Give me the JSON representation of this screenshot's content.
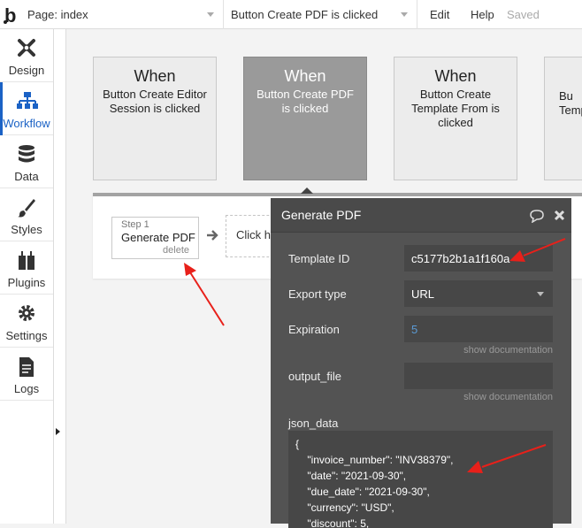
{
  "topbar": {
    "page_select": "Page: index",
    "event_select": "Button Create PDF is clicked",
    "menu_edit": "Edit",
    "menu_help": "Help",
    "status": "Saved"
  },
  "sidebar": {
    "items": [
      {
        "label": "Design",
        "icon": "design-icon"
      },
      {
        "label": "Workflow",
        "icon": "workflow-icon",
        "active": true
      },
      {
        "label": "Data",
        "icon": "data-icon"
      },
      {
        "label": "Styles",
        "icon": "brush-icon"
      },
      {
        "label": "Plugins",
        "icon": "plugins-icon"
      },
      {
        "label": "Settings",
        "icon": "gear-icon"
      },
      {
        "label": "Logs",
        "icon": "logs-icon"
      }
    ]
  },
  "events": [
    {
      "when": "When",
      "text": "Button Create Editor Session is clicked"
    },
    {
      "when": "When",
      "text": "Button Create PDF is clicked",
      "selected": true
    },
    {
      "when": "When",
      "text": "Button Create Template From is clicked"
    },
    {
      "when": "",
      "text": "Bu Temp"
    }
  ],
  "actions": {
    "step_label": "Step 1",
    "step_title": "Generate PDF",
    "step_delete": "delete",
    "click_here": "Click here to add an action..."
  },
  "panel": {
    "title": "Generate PDF",
    "fields": {
      "template_id": {
        "label": "Template ID",
        "value": "c5177b2b1a1f160a"
      },
      "export_type": {
        "label": "Export type",
        "value": "URL"
      },
      "expiration": {
        "label": "Expiration",
        "value": "5",
        "doc": "show documentation"
      },
      "output_file": {
        "label": "output_file",
        "value": "",
        "doc": "show documentation"
      },
      "json_data": {
        "label": "json_data",
        "value": "{\n    \"invoice_number\": \"INV38379\",\n    \"date\": \"2021-09-30\",\n    \"due_date\": \"2021-09-30\",\n    \"currency\": \"USD\",\n    \"discount\": 5,"
      }
    }
  },
  "colors": {
    "accent": "#1b62c5",
    "annotation": "#e8201a",
    "panel_bg": "#535353"
  }
}
